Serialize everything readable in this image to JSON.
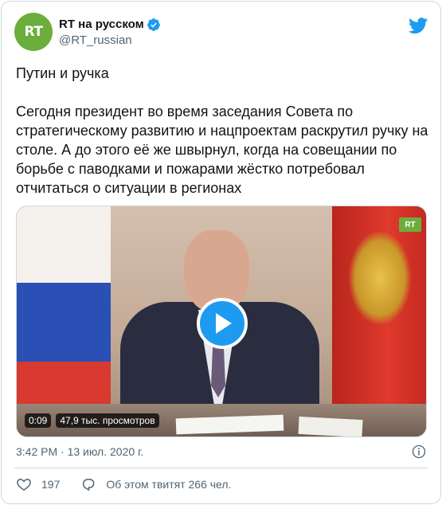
{
  "author": {
    "name": "RT на русском",
    "handle": "@RT_russian",
    "avatar_text": "RT",
    "verified": true
  },
  "tweet": {
    "text": "Путин и ручка\n\nСегодня президент во время заседания Совета по стратегическому развитию и нацпроектам раскрутил ручку на столе. А до этого её же швырнул, когда на совещании по борьбе с паводками и пожарами жёстко потребовал отчитаться о ситуации в регионах"
  },
  "video": {
    "duration": "0:09",
    "views": "47,9 тыс. просмотров",
    "watermark": "RT"
  },
  "meta": {
    "timestamp": "3:42 PM · 13 июл. 2020 г."
  },
  "actions": {
    "likes": "197",
    "reply_label": "Об этом твитят 266 чел."
  },
  "colors": {
    "accent": "#1d9bf0",
    "rt_green": "#6cae3b",
    "text": "#0f1419",
    "muted": "#536471"
  }
}
